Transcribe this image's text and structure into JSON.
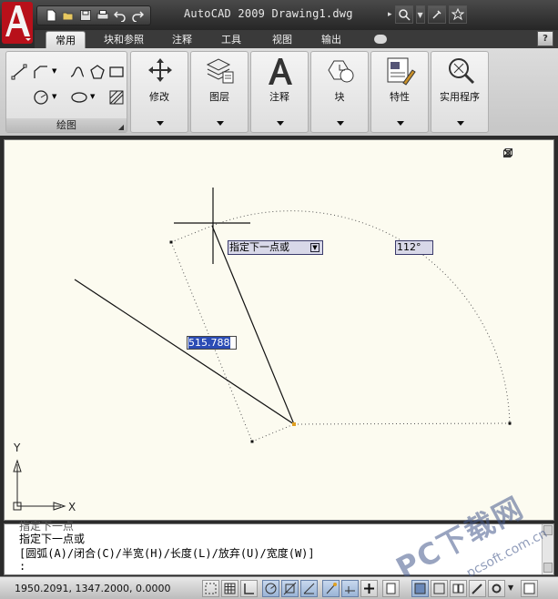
{
  "window": {
    "title": "AutoCAD 2009 Drawing1.dwg"
  },
  "ribbon": {
    "tabs": [
      {
        "label": "常用",
        "active": true
      },
      {
        "label": "块和参照",
        "active": false
      },
      {
        "label": "注释",
        "active": false
      },
      {
        "label": "工具",
        "active": false
      },
      {
        "label": "视图",
        "active": false
      },
      {
        "label": "输出",
        "active": false
      }
    ],
    "help_label": "?",
    "draw_panel_label": "绘图",
    "panels": [
      {
        "label": "修改",
        "icon": "move-arrows-icon"
      },
      {
        "label": "图层",
        "icon": "layers-icon"
      },
      {
        "label": "注释",
        "icon": "text-A-icon"
      },
      {
        "label": "块",
        "icon": "block-insert-icon"
      },
      {
        "label": "特性",
        "icon": "properties-icon"
      },
      {
        "label": "实用程序",
        "icon": "zoom-utility-icon"
      }
    ]
  },
  "canvas": {
    "dynamic_prompt": "指定下一点或",
    "angle_value": "112°",
    "length_value": "515.788",
    "ucs": {
      "y_label": "Y",
      "x_label": "X"
    }
  },
  "command": {
    "partial_line": "指定下一点",
    "line1": "指定下一点或",
    "line2": "[圆弧(A)/闭合(C)/半宽(H)/长度(L)/放弃(U)/宽度(W)]",
    "line3": ":"
  },
  "status": {
    "coordinates": "1950.2091, 1347.2000, 0.0000"
  },
  "watermark": {
    "text": "PC下载网",
    "url": "pcsoft.com.cn"
  },
  "colors": {
    "brand_red": "#c8141e",
    "canvas_bg": "#fcfbf0",
    "dyn_bg": "#d8d8e8",
    "highlight": "#2b4cb5"
  }
}
